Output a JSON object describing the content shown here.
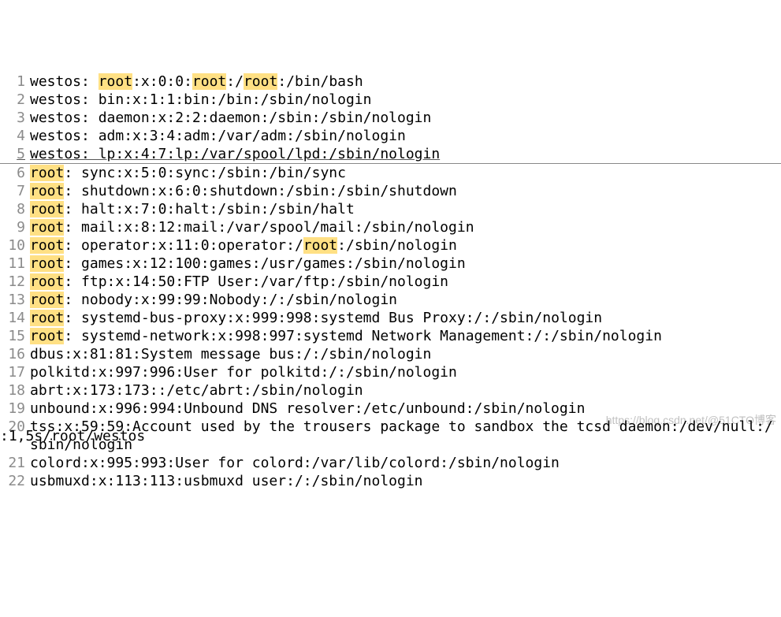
{
  "lines": [
    {
      "n": 1,
      "segs": [
        [
          "westos: ",
          0
        ],
        [
          "root",
          1
        ],
        [
          ":x:0:0:",
          0
        ],
        [
          "root",
          1
        ],
        [
          ":/",
          0
        ],
        [
          "root",
          1
        ],
        [
          ":/bin/bash",
          0
        ]
      ]
    },
    {
      "n": 2,
      "segs": [
        [
          "westos: bin:x:1:1:bin:/bin:/sbin/nologin",
          0
        ]
      ]
    },
    {
      "n": 3,
      "segs": [
        [
          "westos: daemon:x:2:2:daemon:/sbin:/sbin/nologin",
          0
        ]
      ]
    },
    {
      "n": 4,
      "segs": [
        [
          "westos: adm:x:3:4:adm:/var/adm:/sbin/nologin",
          0
        ]
      ]
    },
    {
      "n": 5,
      "segs": [
        [
          "westos: lp:x:4:7:lp:/var/spool/lpd:/sbin/nologin",
          0
        ]
      ],
      "underline": true
    },
    {
      "n": 6,
      "segs": [
        [
          "root",
          1
        ],
        [
          ": sync:x:5:0:sync:/sbin:/bin/sync",
          0
        ]
      ]
    },
    {
      "n": 7,
      "segs": [
        [
          "root",
          1
        ],
        [
          ": shutdown:x:6:0:shutdown:/sbin:/sbin/shutdown",
          0
        ]
      ]
    },
    {
      "n": 8,
      "segs": [
        [
          "root",
          1
        ],
        [
          ": halt:x:7:0:halt:/sbin:/sbin/halt",
          0
        ]
      ]
    },
    {
      "n": 9,
      "segs": [
        [
          "root",
          1
        ],
        [
          ": mail:x:8:12:mail:/var/spool/mail:/sbin/nologin",
          0
        ]
      ]
    },
    {
      "n": 10,
      "segs": [
        [
          "root",
          1
        ],
        [
          ": operator:x:11:0:operator:/",
          0
        ],
        [
          "root",
          1
        ],
        [
          ":/sbin/nologin",
          0
        ]
      ]
    },
    {
      "n": 11,
      "segs": [
        [
          "root",
          1
        ],
        [
          ": games:x:12:100:games:/usr/games:/sbin/nologin",
          0
        ]
      ]
    },
    {
      "n": 12,
      "segs": [
        [
          "root",
          1
        ],
        [
          ": ftp:x:14:50:FTP User:/var/ftp:/sbin/nologin",
          0
        ]
      ]
    },
    {
      "n": 13,
      "segs": [
        [
          "root",
          1
        ],
        [
          ": nobody:x:99:99:Nobody:/:/sbin/nologin",
          0
        ]
      ]
    },
    {
      "n": 14,
      "segs": [
        [
          "root",
          1
        ],
        [
          ": systemd-bus-proxy:x:999:998:systemd Bus Proxy:/:/sbin/nologin",
          0
        ]
      ]
    },
    {
      "n": 15,
      "segs": [
        [
          "root",
          1
        ],
        [
          ": systemd-network:x:998:997:systemd Network Management:/:/sbin/nologin",
          0
        ]
      ]
    },
    {
      "n": 16,
      "segs": [
        [
          "dbus:x:81:81:System message bus:/:/sbin/nologin",
          0
        ]
      ]
    },
    {
      "n": 17,
      "segs": [
        [
          "polkitd:x:997:996:User for polkitd:/:/sbin/nologin",
          0
        ]
      ]
    },
    {
      "n": 18,
      "segs": [
        [
          "abrt:x:173:173::/etc/abrt:/sbin/nologin",
          0
        ]
      ]
    },
    {
      "n": 19,
      "segs": [
        [
          "unbound:x:996:994:Unbound DNS resolver:/etc/unbound:/sbin/nologin",
          0
        ]
      ]
    },
    {
      "n": 20,
      "segs": [
        [
          "tss:x:59:59:Account used by the trousers package to sandbox the tcsd daemon:/dev/null:/sbin/nologin",
          0
        ]
      ],
      "cursor_after_char": 18
    },
    {
      "n": 21,
      "segs": [
        [
          "colord:x:995:993:User for colord:/var/lib/colord:/sbin/nologin",
          0
        ]
      ]
    },
    {
      "n": 22,
      "segs": [
        [
          "usbmuxd:x:113:113:usbmuxd user:/:/sbin/nologin",
          0
        ]
      ]
    }
  ],
  "status_line": ":1,5s/root/westos",
  "watermark": "https://blog.csdn.net/@51CTO博客"
}
